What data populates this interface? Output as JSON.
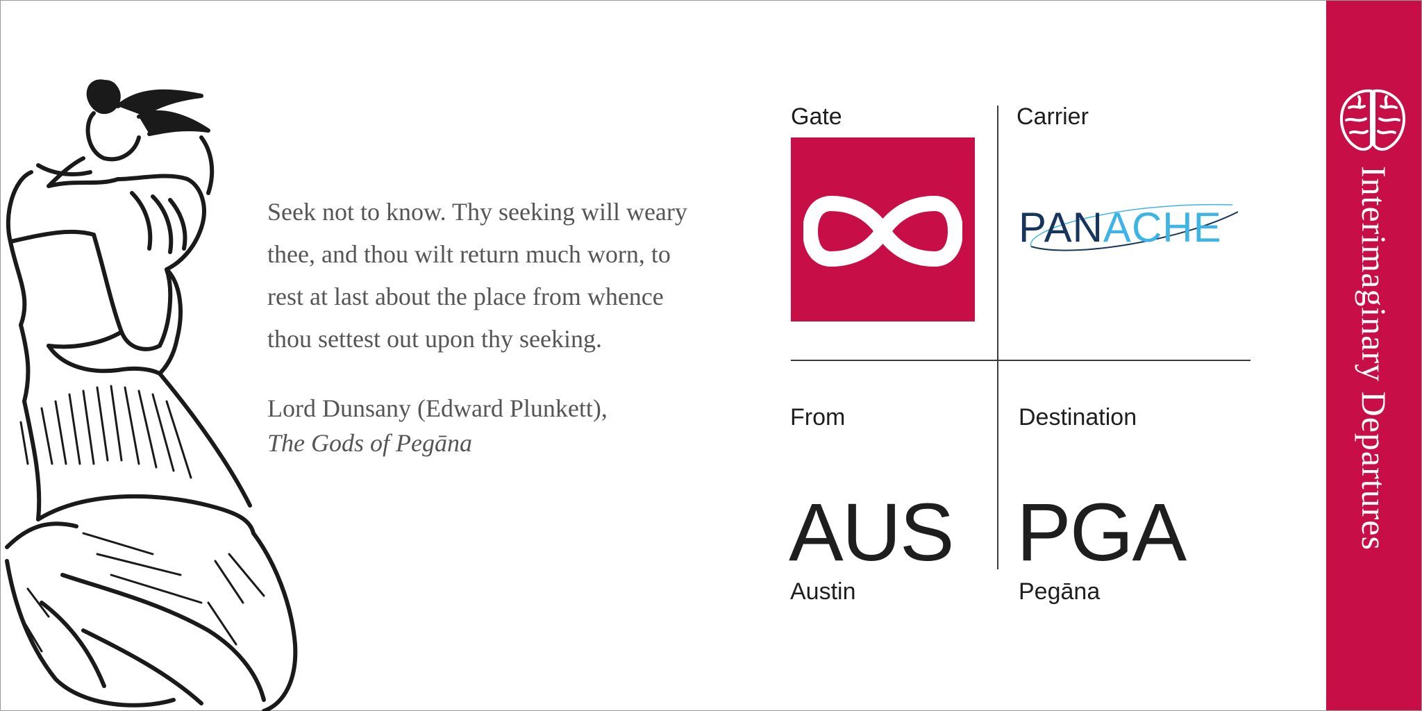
{
  "quote": {
    "lines": [
      "Seek not to know. Thy seeking will weary",
      "thee, and thou wilt return much worn, to",
      "rest at last about the place from whence",
      "thou settest out upon thy seeking."
    ],
    "author": "Lord Dunsany (Edward Plunkett),",
    "book": "The Gods of Pegāna"
  },
  "ticket": {
    "gate_label": "Gate",
    "carrier_label": "Carrier",
    "carrier_name_part1": "PAN",
    "carrier_name_part2": "ACHE",
    "from_label": "From",
    "destination_label": "Destination",
    "from_code": "AUS",
    "from_city": "Austin",
    "destination_code": "PGA",
    "destination_city": "Pegāna"
  },
  "sidebar": {
    "title": "Interimaginary Departures"
  },
  "colors": {
    "brand": "#c80e46",
    "carrier_dark": "#17365d",
    "carrier_light": "#3db4e6",
    "quote_text": "#555555"
  },
  "icons": {
    "gate": "infinity-icon",
    "sidebar": "brain-icon",
    "illustration": "kneeling-woman-illustration"
  }
}
